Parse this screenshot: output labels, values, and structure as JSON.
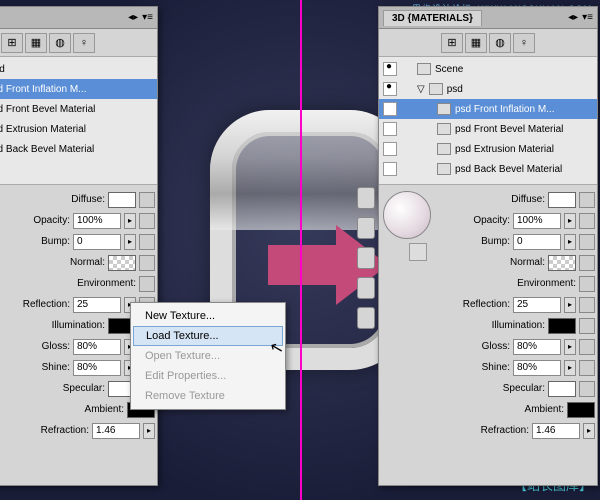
{
  "panel_title": "3D {MATERIALS}",
  "watermarks": {
    "top_cn": "思缘设计论坛",
    "top_en": "WWW.MISSYUAN.COM",
    "bottom": "【站长图库】"
  },
  "scene": {
    "root": "Scene",
    "mesh": "psd",
    "materials": [
      "psd Front Inflation M...",
      "psd Front Bevel Material",
      "psd Extrusion Material",
      "psd Back Bevel Material"
    ]
  },
  "props": {
    "diffuse": {
      "label": "Diffuse:"
    },
    "opacity": {
      "label": "Opacity:",
      "value": "100%"
    },
    "bump": {
      "label": "Bump:",
      "value": "0"
    },
    "normal": {
      "label": "Normal:"
    },
    "environment": {
      "label": "Environment:"
    },
    "reflection": {
      "label": "Reflection:",
      "value": "25"
    },
    "illumination": {
      "label": "Illumination:"
    },
    "gloss": {
      "label": "Gloss:",
      "value": "80%"
    },
    "shine": {
      "label": "Shine:",
      "value": "80%"
    },
    "specular": {
      "label": "Specular:"
    },
    "ambient": {
      "label": "Ambient:"
    },
    "refraction": {
      "label": "Refraction:",
      "value": "1.46"
    }
  },
  "menu": {
    "new": "New Texture...",
    "load": "Load Texture...",
    "open": "Open Texture...",
    "edit": "Edit Properties...",
    "remove": "Remove Texture"
  }
}
